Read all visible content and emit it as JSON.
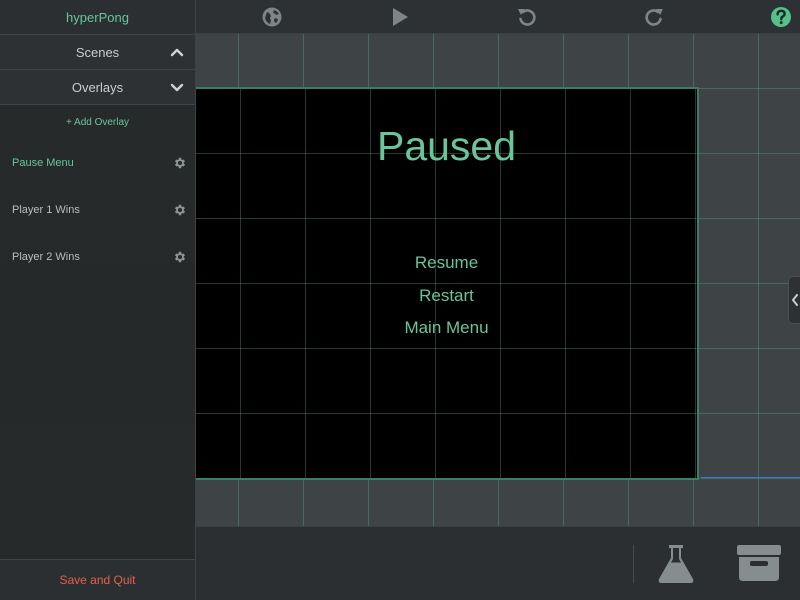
{
  "app": {
    "title": "hyperPong"
  },
  "sidebar": {
    "sections": [
      {
        "label": "Scenes",
        "state": "collapsed"
      },
      {
        "label": "Overlays",
        "state": "expanded"
      }
    ],
    "add_overlay_label": "+ Add Overlay",
    "overlays": [
      {
        "label": "Pause Menu",
        "active": true
      },
      {
        "label": "Player 1 Wins",
        "active": false
      },
      {
        "label": "Player 2 Wins",
        "active": false
      }
    ],
    "footer_label": "Save and Quit"
  },
  "toolbar": {
    "icons": [
      "globe-icon",
      "play-icon",
      "undo-icon",
      "redo-icon",
      "help-icon"
    ]
  },
  "scene": {
    "title": "Paused",
    "menu": [
      "Resume",
      "Restart",
      "Main Menu"
    ]
  },
  "bottombar": {
    "icons": [
      "flask-icon",
      "archive-icon"
    ]
  },
  "colors": {
    "accent": "#6ac59a",
    "danger": "#e2614a",
    "panel": "#2b2f31",
    "canvas": "#3e4446"
  }
}
